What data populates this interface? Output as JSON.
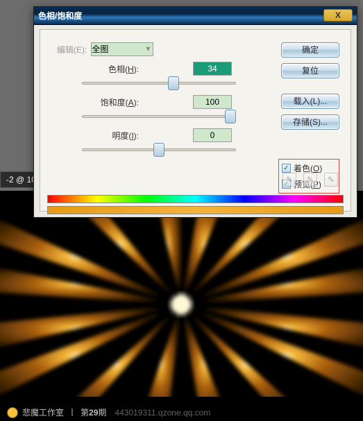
{
  "doc_tab": "-2 @ 10",
  "dialog": {
    "title": "色相/饱和度",
    "close_glyph": "X",
    "edit_label": "编辑(E):",
    "combo_value": "全图",
    "hue": {
      "label_pre": "色相(",
      "key": "H",
      "label_post": "):",
      "value": "34"
    },
    "sat": {
      "label_pre": "饱和度(",
      "key": "A",
      "label_post": "):",
      "value": "100"
    },
    "lig": {
      "label_pre": "明度(",
      "key": "I",
      "label_post": "):",
      "value": "0"
    },
    "buttons": {
      "ok": "确定",
      "reset": "复位",
      "load": "载入(L)...",
      "save": "存储(S)..."
    },
    "colorize": {
      "pre": "着色(",
      "key": "O",
      "post": ")"
    },
    "preview": {
      "pre": "预览(",
      "key": "P",
      "post": ")"
    },
    "check_glyph": "✓",
    "eyedrop_glyph": "✎"
  },
  "footer": {
    "studio": "悲魔工作室",
    "sep": "丨",
    "issue_pre": "第",
    "issue_no": "29",
    "issue_post": "期",
    "url": "443019311.qzone.qq.com"
  }
}
